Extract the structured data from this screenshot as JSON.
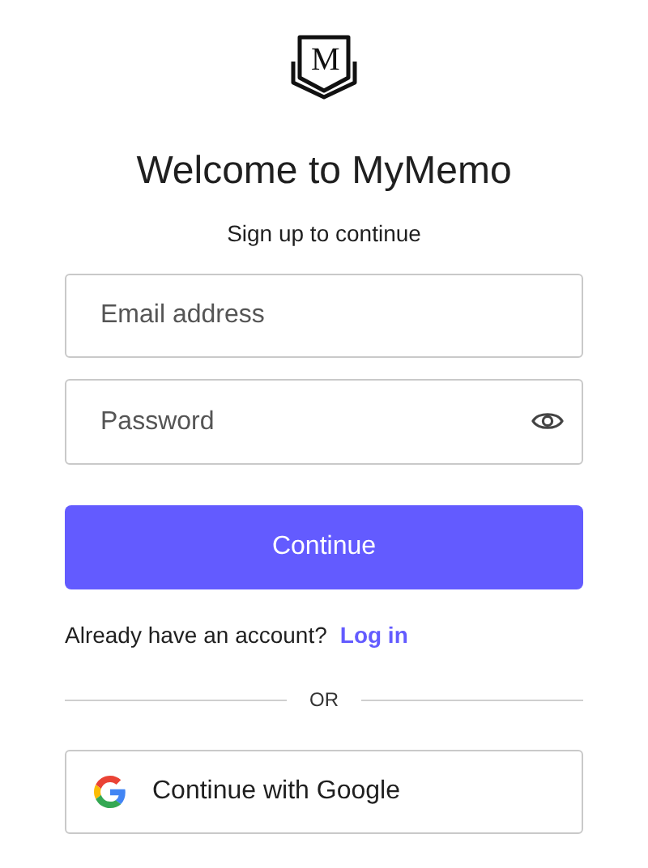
{
  "logo": {
    "letter": "M"
  },
  "title": "Welcome to MyMemo",
  "subtitle": "Sign up to continue",
  "email_field": {
    "placeholder": "Email address"
  },
  "password_field": {
    "placeholder": "Password"
  },
  "continue_button": "Continue",
  "login_prompt": {
    "text": "Already have an account?",
    "link": "Log in"
  },
  "divider": "OR",
  "google_button": "Continue with Google"
}
